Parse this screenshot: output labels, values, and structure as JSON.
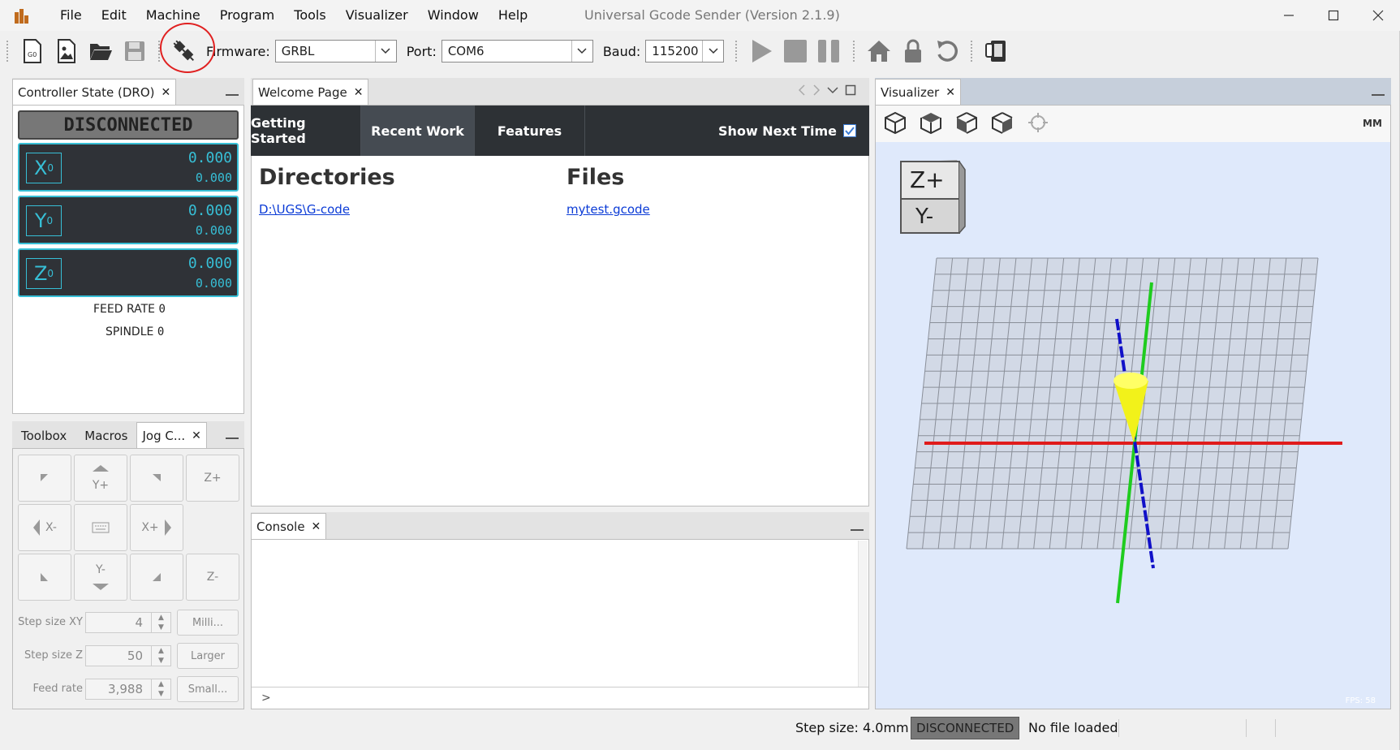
{
  "window": {
    "title": "Universal Gcode Sender (Version 2.1.9)",
    "minimize_icon": "minimize-icon",
    "maximize_icon": "maximize-icon",
    "close_icon": "close-icon"
  },
  "menu": [
    "File",
    "Edit",
    "Machine",
    "Program",
    "Tools",
    "Visualizer",
    "Window",
    "Help"
  ],
  "toolbar": {
    "firmware_label": "Firmware:",
    "firmware_value": "GRBL",
    "port_label": "Port:",
    "port_value": "COM6",
    "baud_label": "Baud:",
    "baud_value": "115200",
    "icons": [
      "gcode-file-icon",
      "image-file-icon",
      "open-folder-icon",
      "save-icon",
      "connect-icon",
      "play-icon",
      "stop-icon",
      "pause-icon",
      "home-icon",
      "unlock-icon",
      "reset-icon",
      "soft-reset-icon"
    ]
  },
  "dro": {
    "tab_label": "Controller State (DRO)",
    "status": "DISCONNECTED",
    "axes": [
      {
        "name": "X",
        "sub": "0",
        "work": "0.000",
        "machine": "0.000"
      },
      {
        "name": "Y",
        "sub": "0",
        "work": "0.000",
        "machine": "0.000"
      },
      {
        "name": "Z",
        "sub": "0",
        "work": "0.000",
        "machine": "0.000"
      }
    ],
    "feed_rate_label": "FEED RATE",
    "feed_rate_value": "0",
    "spindle_label": "SPINDLE",
    "spindle_value": "0"
  },
  "jog": {
    "tabs": [
      "Toolbox",
      "Macros",
      "Jog C..."
    ],
    "buttons": {
      "y_plus": "Y+",
      "y_minus": "Y-",
      "x_plus": "X+",
      "x_minus": "X-",
      "z_plus": "Z+",
      "z_minus": "Z-"
    },
    "step_xy_label": "Step size XY",
    "step_xy_value": "4",
    "step_z_label": "Step size Z",
    "step_z_value": "50",
    "feed_label": "Feed rate",
    "feed_value": "3,988",
    "unit_button": "Milli...",
    "larger_button": "Larger",
    "smaller_button": "Small..."
  },
  "welcome": {
    "tab_label": "Welcome Page",
    "nav": [
      "Getting Started",
      "Recent Work",
      "Features"
    ],
    "show_next_time": "Show Next Time",
    "directories_heading": "Directories",
    "files_heading": "Files",
    "directory_link": "D:\\UGS\\G-code",
    "file_link": "mytest.gcode"
  },
  "console": {
    "tab_label": "Console",
    "prompt": ">"
  },
  "visualizer": {
    "tab_label": "Visualizer",
    "units": "MM",
    "cube_top": "Z+",
    "cube_front": "Y-",
    "fps": "FPS: 58",
    "colors": {
      "x_axis": "#e01b1b",
      "y_axis": "#1fcc1f",
      "z_axis": "#1010c8",
      "tool": "#ffff22",
      "grid": "#8a8f99",
      "background": "#dfe9fb"
    }
  },
  "status": {
    "step_size": "Step size: 4.0mm",
    "connection": "DISCONNECTED",
    "file": "No file loaded"
  }
}
